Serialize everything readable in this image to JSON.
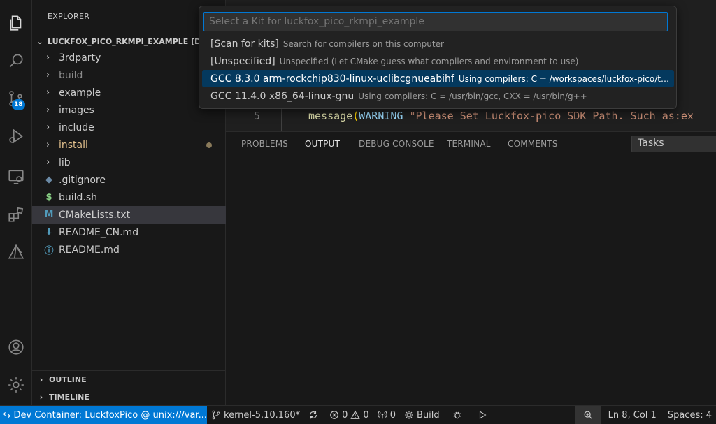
{
  "activity_bar": {
    "items": [
      {
        "name": "explorer-icon"
      },
      {
        "name": "search-icon"
      },
      {
        "name": "source-control-icon",
        "badge": "18"
      },
      {
        "name": "run-debug-icon"
      },
      {
        "name": "remote-explorer-icon"
      },
      {
        "name": "extensions-icon"
      },
      {
        "name": "cmake-icon"
      },
      {
        "name": "account-icon"
      },
      {
        "name": "manage-gear-icon"
      }
    ]
  },
  "sidebar": {
    "title": "EXPLORER",
    "root_label": "LUCKFOX_PICO_RKMPI_EXAMPLE [D...",
    "items": [
      {
        "label": "3rdparty",
        "type": "folder"
      },
      {
        "label": "build",
        "type": "folder",
        "state": "dim"
      },
      {
        "label": "example",
        "type": "folder"
      },
      {
        "label": "images",
        "type": "folder"
      },
      {
        "label": "include",
        "type": "folder"
      },
      {
        "label": "install",
        "type": "folder",
        "state": "modified"
      },
      {
        "label": "lib",
        "type": "folder"
      },
      {
        "label": ".gitignore",
        "type": "file",
        "icon": "gitignore-icon"
      },
      {
        "label": "build.sh",
        "type": "file",
        "icon": "shell-dollar-icon"
      },
      {
        "label": "CMakeLists.txt",
        "type": "file",
        "icon": "cmake-m-icon",
        "state": "selected"
      },
      {
        "label": "README_CN.md",
        "type": "file",
        "icon": "download-arrow-icon"
      },
      {
        "label": "README.md",
        "type": "file",
        "icon": "info-icon"
      }
    ],
    "outline_label": "OUTLINE",
    "timeline_label": "TIMELINE"
  },
  "editor": {
    "line_number": "5",
    "code_func": "message",
    "code_open": "(",
    "code_ident": "WARNING",
    "code_string": "\"Please Set Luckfox-pico SDK Path. Such as:ex"
  },
  "quick_pick": {
    "placeholder": "Select a Kit for luckfox_pico_rkmpi_example",
    "items": [
      {
        "label": "[Scan for kits]",
        "description": "Search for compilers on this computer"
      },
      {
        "label": "[Unspecified]",
        "description": "Unspecified (Let CMake guess what compilers and environment to use)"
      },
      {
        "label": "GCC 8.3.0 arm-rockchip830-linux-uclibcgnueabihf",
        "description": "Using compilers: C = /workspaces/luckfox-pico/to…",
        "active": true
      },
      {
        "label": "GCC 11.4.0 x86_64-linux-gnu",
        "description": "Using compilers: C = /usr/bin/gcc, CXX = /usr/bin/g++"
      }
    ]
  },
  "panel": {
    "tabs": [
      "PROBLEMS",
      "OUTPUT",
      "DEBUG CONSOLE",
      "TERMINAL",
      "COMMENTS"
    ],
    "active_tab": "OUTPUT",
    "tasks_label": "Tasks"
  },
  "status_bar": {
    "remote": "Dev Container: LuckfoxPico @ unix:///var...",
    "branch": "kernel-5.10.160*",
    "errors": "0",
    "warnings": "0",
    "ports": "0",
    "build": "Build",
    "cursor": "Ln 8, Col 1",
    "spaces": "Spaces: 4"
  },
  "colors": {
    "accent": "#0078d4",
    "background": "#1f1f1f",
    "sidebar": "#181818",
    "selection": "#04395e",
    "modified": "#e2c08d"
  }
}
